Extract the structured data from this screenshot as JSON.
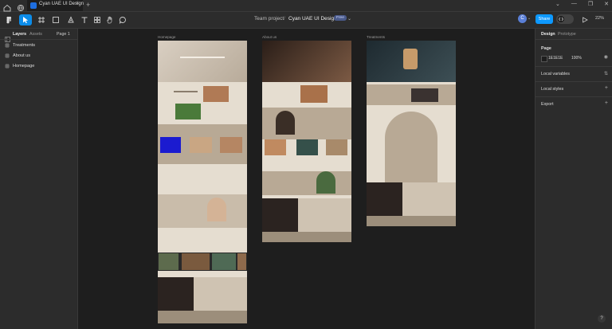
{
  "titlebar": {
    "tab_title": "Cyan UAE UI Design",
    "new_tab": "+",
    "window_controls": [
      "⌄",
      "—",
      "❐",
      "✕"
    ]
  },
  "toolbar": {
    "breadcrumb_project": "Team project",
    "breadcrumb_sep": "/",
    "file_name": "Cyan UAE UI Design",
    "plan_badge": "Free",
    "avatar_initial": "C",
    "share_label": "Share",
    "zoom": "22%"
  },
  "left_panel": {
    "tabs": [
      "Layers",
      "Assets"
    ],
    "page_selector": "Page 1",
    "layers": [
      "Treatments",
      "About us",
      "Homepage"
    ]
  },
  "right_panel": {
    "tabs": [
      "Design",
      "Prototype"
    ],
    "page_heading": "Page",
    "bg_color_hex": "1E1E1E",
    "bg_opacity": "100%",
    "sections": [
      "Local variables",
      "Local styles",
      "Export"
    ]
  },
  "canvas": {
    "frames": [
      {
        "label": "Homepage"
      },
      {
        "label": "About us"
      },
      {
        "label": "Treatments"
      }
    ]
  },
  "help": "?",
  "colors": {
    "accent": "#0d99ff",
    "canvas_bg": "#1e1e1e",
    "panel_bg": "#2c2c2c",
    "beige": "#e5ddd0",
    "taupe": "#b8a995",
    "dark": "#1f1f1f"
  }
}
